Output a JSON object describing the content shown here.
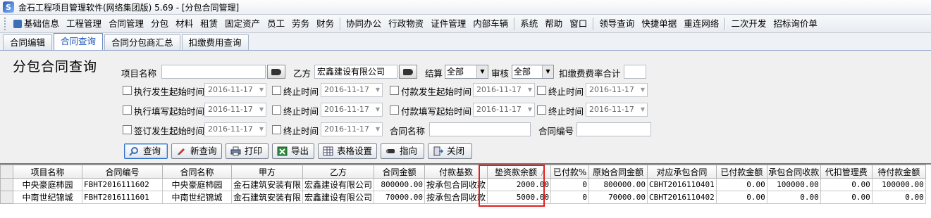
{
  "window": {
    "title": "金石工程项目管理软件(网络集团版) 5.69 - [分包合同管理]",
    "logo_letter": "S"
  },
  "menu": {
    "items": [
      "基础信息",
      "工程管理",
      "合同管理",
      "分包",
      "材料",
      "租赁",
      "固定资产",
      "员工",
      "劳务",
      "财务",
      "协同办公",
      "行政物资",
      "证件管理",
      "内部车辆",
      "系统",
      "帮助",
      "窗口",
      "领导查询",
      "快捷单据",
      "重连网络",
      "二次开发",
      "招标询价单"
    ]
  },
  "tabs": [
    {
      "label": "合同编辑",
      "active": false
    },
    {
      "label": "合同查询",
      "active": true
    },
    {
      "label": "合同分包商汇总",
      "active": false
    },
    {
      "label": "扣缴费用查询",
      "active": false
    }
  ],
  "form": {
    "page_title": "分包合同查询",
    "project_name_label": "项目名称",
    "project_name_value": "",
    "party_b_label": "乙方",
    "party_b_value": "宏鑫建设有限公司",
    "settle_label": "结算",
    "settle_value": "全部",
    "audit_label": "审核",
    "audit_value": "全部",
    "deduct_rate_label": "扣缴费费率合计",
    "deduct_rate_value": "",
    "exec_start_label": "执行发生起始时间",
    "exec_end_label": "终止时间",
    "pay_start_label": "付款发生起始时间",
    "pay_end_label": "终止时间",
    "exec_fill_start_label": "执行填写起始时间",
    "exec_fill_end_label": "终止时间",
    "pay_fill_start_label": "付款填写起始时间",
    "pay_fill_end_label": "终止时间",
    "sign_start_label": "签订发生起始时间",
    "sign_end_label": "终止时间",
    "contract_name_label": "合同名称",
    "contract_name_value": "",
    "contract_no_label": "合同编号",
    "contract_no_value": "",
    "date_value": "2016-11-17"
  },
  "actions": {
    "query": "查询",
    "new_query": "新查询",
    "print": "打印",
    "export": "导出",
    "table_settings": "表格设置",
    "point_to": "指向",
    "close": "关闭"
  },
  "table": {
    "columns": [
      "项目名称",
      "合同编号",
      "合同名称",
      "甲方",
      "乙方",
      "合同金额",
      "付款基数",
      "垫资款余额",
      "已付款%",
      "原始合同金额",
      "对应承包合同",
      "已付款金额",
      "承包合同收款",
      "代扣管理费",
      "待付款金额"
    ],
    "rows": [
      [
        "中央豪庭柿园",
        "FBHT2016111602",
        "中央豪庭柿园",
        "金石建筑安装有限",
        "宏鑫建设有限公司",
        "800000.00",
        "按承包合同收款",
        "2000.00",
        "0",
        "800000.00",
        "CBHT2016110401",
        "0.00",
        "100000.00",
        "0.00",
        "100000.00"
      ],
      [
        "中南世纪锦城",
        "FBHT2016111601",
        "中南世纪锦城",
        "金石建筑安装有限",
        "宏鑫建设有限公司",
        "70000.00",
        "按承包合同收款",
        "5000.00",
        "0",
        "70000.00",
        "CBHT2016110402",
        "0.00",
        "0.00",
        "0.00",
        "0.00"
      ]
    ],
    "sort_mark": "/"
  },
  "colors": {
    "highlight": "#e02020",
    "active_tab_text": "#1a55b8"
  }
}
